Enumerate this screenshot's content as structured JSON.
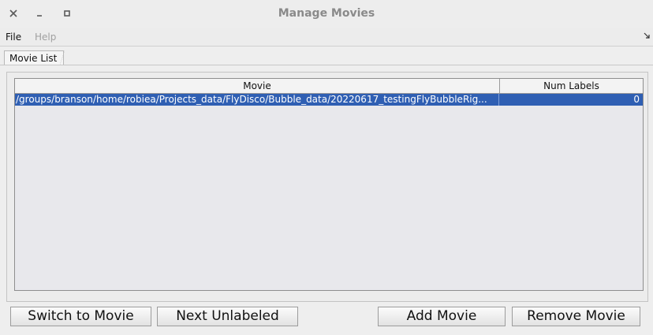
{
  "window": {
    "title": "Manage Movies",
    "close_glyph": "✕",
    "minimize_glyph": "—",
    "maximize_glyph": "▫"
  },
  "menubar": {
    "file": "File",
    "help": "Help"
  },
  "tabs": [
    {
      "label": "Movie List",
      "active": true
    }
  ],
  "table": {
    "columns": [
      "Movie",
      "Num Labels"
    ],
    "rows": [
      {
        "movie": "/groups/branson/home/robiea/Projects_data/FlyDisco/Bubble_data/20220617_testingFlyBubbleRig...",
        "num_labels": "0",
        "selected": true
      }
    ]
  },
  "buttons": {
    "switch": "Switch to Movie",
    "next": "Next Unlabeled",
    "add": "Add Movie",
    "remove": "Remove Movie"
  },
  "colors": {
    "selection": "#2f5fb3",
    "background": "#eeeeee"
  },
  "icons": {
    "close": "close-icon",
    "minimize": "minimize-icon",
    "maximize": "maximize-icon",
    "menu_corner": "resize-corner-icon"
  }
}
